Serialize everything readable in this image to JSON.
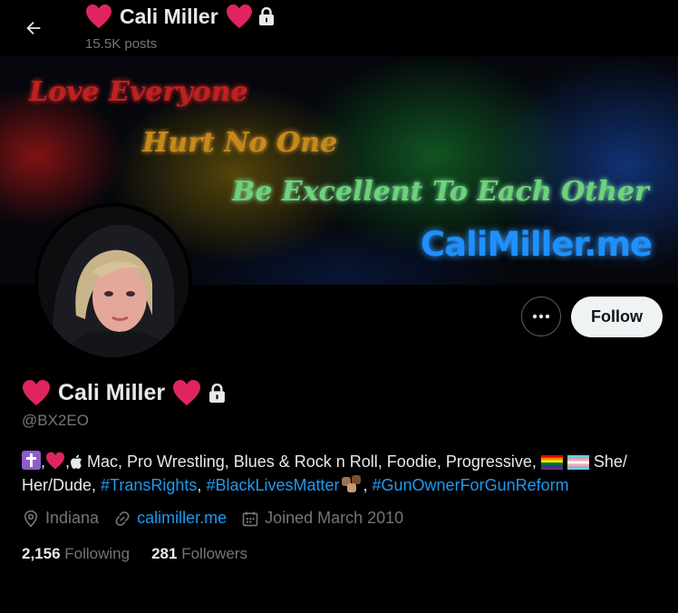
{
  "header": {
    "title": "Cali Miller",
    "posts_count": "15.5K posts"
  },
  "banner": {
    "line1": "Love Everyone",
    "line2": "Hurt No One",
    "line3": "Be Excellent To Each Other",
    "site": "CaliMiller.me"
  },
  "profile": {
    "display_name": "Cali Miller",
    "handle": "@BX2EO",
    "follow_label": "Follow"
  },
  "bio": {
    "sep1": ",",
    "sep2": ",",
    "text_main": " Mac, Pro Wrestling, Blues & Rock n Roll, Foodie, Progressive, ",
    "text_pronouns": " She/ Her/Dude, ",
    "tag1": "#TransRights",
    "sep3": ", ",
    "tag2": "#BlackLivesMatter",
    "sep4": ", ",
    "tag3": "#GunOwnerForGunReform"
  },
  "meta": {
    "location": "Indiana",
    "website": "calimiller.me",
    "joined": "Joined March 2010"
  },
  "stats": {
    "following_count": "2,156",
    "following_label": "Following",
    "followers_count": "281",
    "followers_label": "Followers"
  },
  "colors": {
    "accent": "#1d9bf0",
    "heart": "#e0245e",
    "muted": "#71767b"
  }
}
